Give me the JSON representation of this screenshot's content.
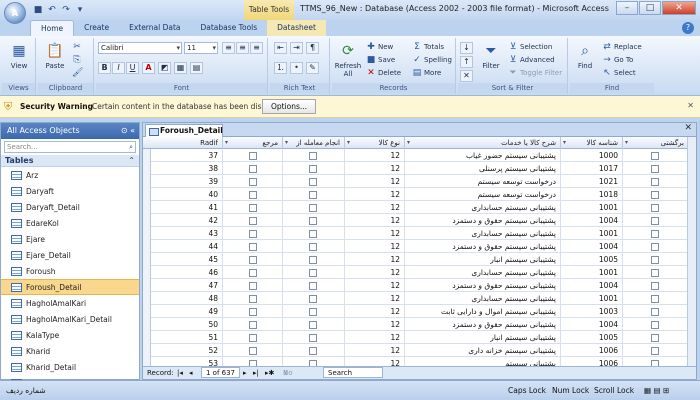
{
  "window": {
    "title": "TTMS_96_New : Database (Access 2002 - 2003 file format) - Microsoft Access",
    "context_tab": "Table Tools",
    "office_button": "A"
  },
  "ribbon_tabs": [
    "Home",
    "Create",
    "External Data",
    "Database Tools",
    "Datasheet"
  ],
  "ribbon": {
    "views": {
      "view_label": "View",
      "group": "Views"
    },
    "clipboard": {
      "paste_label": "Paste",
      "group": "Clipboard"
    },
    "font": {
      "font_name": "Calibri",
      "font_size": "11",
      "bold": "B",
      "italic": "I",
      "underline": "U",
      "font_color": "A",
      "group": "Font"
    },
    "rich_text": {
      "group": "Rich Text"
    },
    "records": {
      "refresh_label": "Refresh",
      "refresh_sub": "All",
      "new": "New",
      "save": "Save",
      "delete": "Delete",
      "totals": "Totals",
      "spelling": "Spelling",
      "more": "More",
      "group": "Records"
    },
    "sort_filter": {
      "filter_label": "Filter",
      "selection": "Selection",
      "advanced": "Advanced",
      "toggle_filter": "Toggle Filter",
      "group": "Sort & Filter"
    },
    "find": {
      "find_label": "Find",
      "replace": "Replace",
      "goto": "Go To",
      "select": "Select",
      "group": "Find"
    }
  },
  "security": {
    "title": "Security Warning",
    "message": "Certain content in the database has been disabled",
    "options_button": "Options..."
  },
  "nav_pane": {
    "header": "All Access Objects",
    "search_placeholder": "Search...",
    "group": "Tables",
    "items": [
      "Arz",
      "Daryaft",
      "Daryaft_Detail",
      "EdareKol",
      "Ejare",
      "Ejare_Detail",
      "Foroush",
      "Foroush_Detail",
      "HagholAmalKari",
      "HagholAmalKari_Detail",
      "KalaType",
      "Kharid",
      "Kharid_Detail",
      "Movhakhasat"
    ],
    "selected_index": 7
  },
  "document_tab": "Foroush_Detail",
  "columns": {
    "radif": "Radif",
    "marja": "مرجع",
    "anjam": "انجام معامله از",
    "noe_kala": "نوع کالا",
    "sharh": "شرح کالا یا خدمات",
    "shenase": "شناسه کالا",
    "bargashti": "برگشتی"
  },
  "rows": [
    {
      "radif": "37",
      "noe": "12",
      "sharh": "پشتیبانی سیستم حضور غیاب",
      "shenase": "1000"
    },
    {
      "radif": "38",
      "noe": "12",
      "sharh": "پشتیبانی سیستم پرسنلی",
      "shenase": "1017"
    },
    {
      "radif": "39",
      "noe": "12",
      "sharh": "درخواست توسعه سیستم",
      "shenase": "1021"
    },
    {
      "radif": "40",
      "noe": "12",
      "sharh": "درخواست توسعه سیستم",
      "shenase": "1018"
    },
    {
      "radif": "41",
      "noe": "12",
      "sharh": "پشتیبانی سیستم حسابداری",
      "shenase": "1001"
    },
    {
      "radif": "42",
      "noe": "12",
      "sharh": "پشتیبانی سیستم حقوق و دستمزد",
      "shenase": "1004"
    },
    {
      "radif": "43",
      "noe": "12",
      "sharh": "پشتیبانی سیستم حسابداری",
      "shenase": "1001"
    },
    {
      "radif": "44",
      "noe": "12",
      "sharh": "پشتیبانی سیستم حقوق و دستمزد",
      "shenase": "1004"
    },
    {
      "radif": "45",
      "noe": "12",
      "sharh": "پشتیبانی سیستم انبار",
      "shenase": "1005"
    },
    {
      "radif": "46",
      "noe": "12",
      "sharh": "پشتیبانی سیستم حسابداری",
      "shenase": "1001"
    },
    {
      "radif": "47",
      "noe": "12",
      "sharh": "پشتیبانی سیستم حقوق و دستمزد",
      "shenase": "1004"
    },
    {
      "radif": "48",
      "noe": "12",
      "sharh": "پشتیبانی سیستم حسابداری",
      "shenase": "1001"
    },
    {
      "radif": "49",
      "noe": "12",
      "sharh": "پشتیبانی سیستم اموال و دارایی ثابت",
      "shenase": "1003"
    },
    {
      "radif": "50",
      "noe": "12",
      "sharh": "پشتیبانی سیستم حقوق و دستمزد",
      "shenase": "1004"
    },
    {
      "radif": "51",
      "noe": "12",
      "sharh": "پشتیبانی سیستم انبار",
      "shenase": "1005"
    },
    {
      "radif": "52",
      "noe": "12",
      "sharh": "پشتیبانی سیستم خزانه داری",
      "shenase": "1006"
    },
    {
      "radif": "53",
      "noe": "12",
      "sharh": "پشتیبانی سیستم",
      "shenase": "1006"
    }
  ],
  "record_nav": {
    "label": "Record:",
    "position": "1 of 637",
    "filter": "No Filter",
    "search": "Search"
  },
  "status": {
    "left": "شماره ردیف",
    "caps": "Caps Lock",
    "num": "Num Lock",
    "scroll": "Scroll Lock"
  }
}
